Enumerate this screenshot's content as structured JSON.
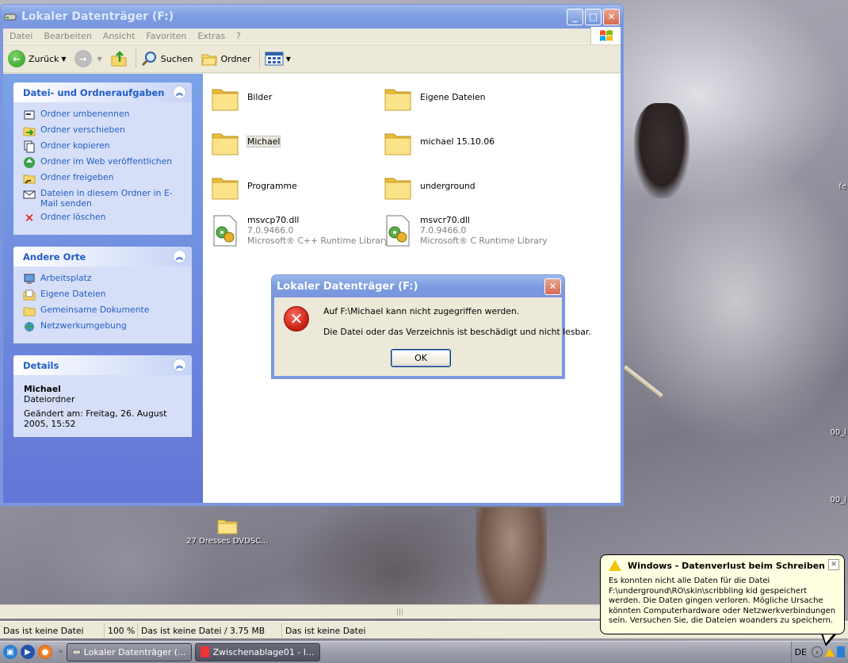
{
  "explorer": {
    "title": "Lokaler Datenträger (F:)",
    "menu": [
      "Datei",
      "Bearbeiten",
      "Ansicht",
      "Favoriten",
      "Extras",
      "?"
    ],
    "toolbar": {
      "back": "Zurück",
      "search": "Suchen",
      "folders": "Ordner"
    },
    "tasks_panel": {
      "title": "Datei- und Ordneraufgaben",
      "items": [
        "Ordner umbenennen",
        "Ordner verschieben",
        "Ordner kopieren",
        "Ordner im Web veröffentlichen",
        "Ordner freigeben",
        "Dateien in diesem Ordner in E-Mail senden",
        "Ordner löschen"
      ]
    },
    "places_panel": {
      "title": "Andere Orte",
      "items": [
        "Arbeitsplatz",
        "Eigene Dateien",
        "Gemeinsame Dokumente",
        "Netzwerkumgebung"
      ]
    },
    "details_panel": {
      "title": "Details",
      "name": "Michael",
      "type": "Dateiordner",
      "modified": "Geändert am: Freitag, 26. August 2005, 15:52"
    },
    "files": [
      {
        "name": "Bilder"
      },
      {
        "name": "Eigene Dateien"
      },
      {
        "name": "Michael"
      },
      {
        "name": "michael 15.10.06"
      },
      {
        "name": "Programme"
      },
      {
        "name": "underground"
      },
      {
        "name": "msvcp70.dll",
        "version": "7.0.9466.0",
        "desc": "Microsoft® C++ Runtime Library"
      },
      {
        "name": "msvcr70.dll",
        "version": "7.0.9466.0",
        "desc": "Microsoft® C Runtime Library"
      }
    ]
  },
  "dialog": {
    "title": "Lokaler Datenträger (F:)",
    "line1": "Auf F:\\Michael kann nicht zugegriffen werden.",
    "line2": "Die Datei oder das Verzeichnis ist beschädigt und nicht lesbar.",
    "ok": "OK"
  },
  "statusbar": {
    "cell1": "Das ist keine Datei",
    "cell2": "100 %",
    "cell3": "Das ist keine Datei / 3.75 MB",
    "cell4": "Das ist keine Datei"
  },
  "desktop": {
    "icon_label": "27 Dresses DVDSC..."
  },
  "taskbar": {
    "tasks": [
      "Lokaler Datenträger (...",
      "Zwischenablage01 - I..."
    ],
    "lang": "DE"
  },
  "balloon": {
    "title": "Windows - Datenverlust beim Schreiben",
    "text": "Es konnten nicht alle Daten für die Datei F:\\underground\\RO\\skin\\scribbling kid gespeichert werden. Die Daten gingen verloren. Mögliche Ursache könnten Computerhardware oder Netzwerkverbindungen sein. Versuchen Sie, die Dateien woanders zu speichern."
  },
  "colors": {
    "task_link": "#215dc6",
    "window_face": "#ece9d8",
    "folder_yellow": "#f7d66a",
    "error_red": "#c61b10",
    "balloon_bg": "#ffffe1"
  }
}
